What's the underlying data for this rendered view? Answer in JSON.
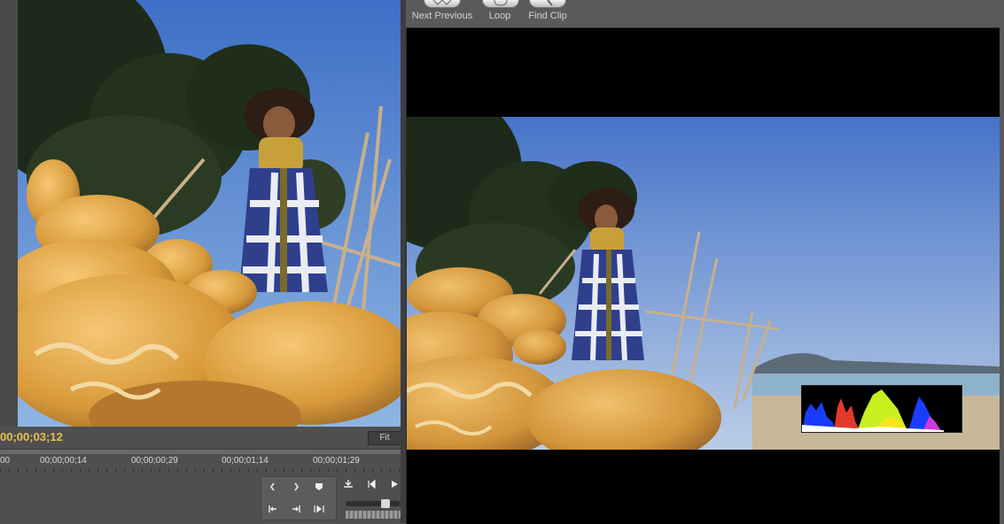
{
  "source_monitor": {
    "timecode": "00;00;03;12",
    "fit_label": "Fit",
    "ruler": [
      "00",
      "00;00;00;14",
      "00;00;00;29",
      "00;00;01;14",
      "00;00;01;29"
    ]
  },
  "program_monitor": {
    "toolbar": [
      {
        "label": "Next Previous",
        "icon": "next-previous-icon"
      },
      {
        "label": "Loop",
        "icon": "loop-icon"
      },
      {
        "label": "Find Clip",
        "icon": "find-clip-icon"
      }
    ],
    "histogram_colors": [
      "#1a3cff",
      "#e23a2a",
      "#c8f01e",
      "#f6e51a",
      "#d03ad8",
      "#ffffff"
    ]
  },
  "colors": {
    "timecode": "#e8c14a",
    "panel_bg": "#535353",
    "viewer_bg": "#000000",
    "sky": "#5e8fd8"
  }
}
